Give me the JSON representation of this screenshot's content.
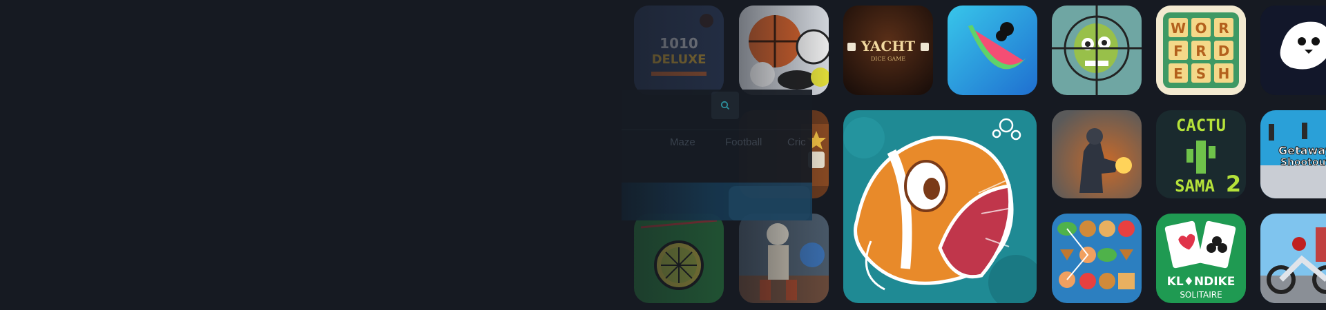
{
  "search": {
    "icon": "search-icon"
  },
  "categories": [
    "Maze",
    "Football",
    "Cric"
  ],
  "games": [
    {
      "name": "1010 Deluxe",
      "label": "1010",
      "sublabel": "DELUXE"
    },
    {
      "name": "Sports balls"
    },
    {
      "name": "Yacht Dice Game",
      "label": "YACHT",
      "sublabel": "DICE GAME"
    },
    {
      "name": "Watermelon slice"
    },
    {
      "name": "Zombie sniper"
    },
    {
      "name": "Word Fresh",
      "letters": [
        "W",
        "O",
        "R",
        "F",
        "R",
        "D",
        "E",
        "S",
        "H"
      ]
    },
    {
      "name": "White bird"
    },
    {
      "name": "Star game"
    },
    {
      "name": "Fish",
      "featured": true
    },
    {
      "name": "Soldier shooter"
    },
    {
      "name": "Cactu Sama 2",
      "label": "CACTU",
      "sublabel": "SAMA",
      "badge": "2"
    },
    {
      "name": "Getaway Shootout",
      "label": "Getaway",
      "sublabel": "Shootout"
    },
    {
      "name": "Lime"
    },
    {
      "name": "Skeleton warrior"
    },
    {
      "name": "Cookie match"
    },
    {
      "name": "Klondike Solitaire",
      "label": "KL♦NDIKE",
      "sublabel": "SOLITAIRE"
    },
    {
      "name": "Moto rider"
    }
  ],
  "colors": {
    "background": "#161a22",
    "fish_bg": "#1f8a94",
    "accent_orange": "#e88a2a"
  }
}
